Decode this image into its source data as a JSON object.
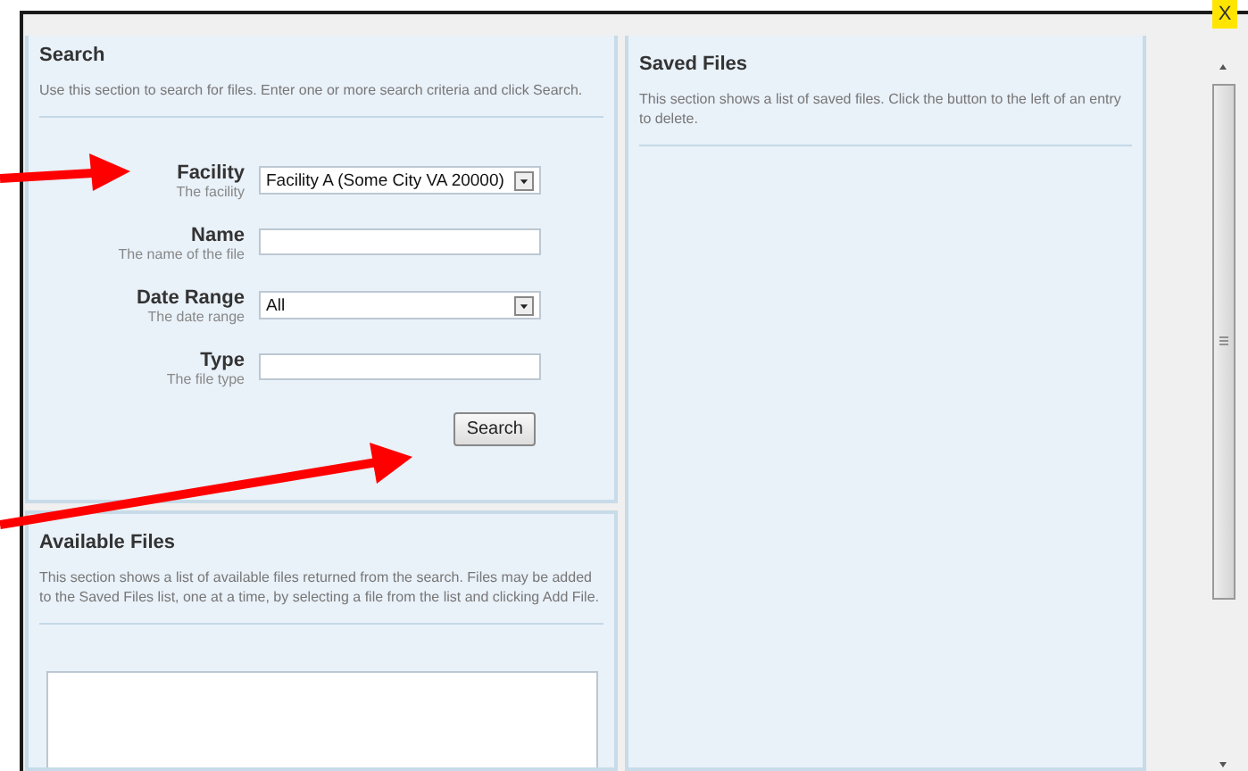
{
  "search": {
    "title": "Search",
    "description": "Use this section to search for files. Enter one or more search criteria and click Search.",
    "fields": [
      {
        "kind": "select",
        "label": "Facility",
        "hint": "The facility",
        "value": "Facility A (Some City VA 20000)"
      },
      {
        "kind": "text",
        "label": "Name",
        "hint": "The name of the file"
      },
      {
        "kind": "select",
        "label": "Date Range",
        "hint": "The date range",
        "value": "All"
      },
      {
        "kind": "text",
        "label": "Type",
        "hint": "The file type"
      }
    ],
    "button": "Search"
  },
  "available_files": {
    "title": "Available Files",
    "description": "This section shows a list of available files returned from the search. Files may be added to the Saved Files list, one at a time, by selecting a file from the list and clicking Add File."
  },
  "saved_files": {
    "title": "Saved Files",
    "description": "This section shows a list of saved files. Click the button to the left of an entry to delete."
  },
  "close_button": "X"
}
